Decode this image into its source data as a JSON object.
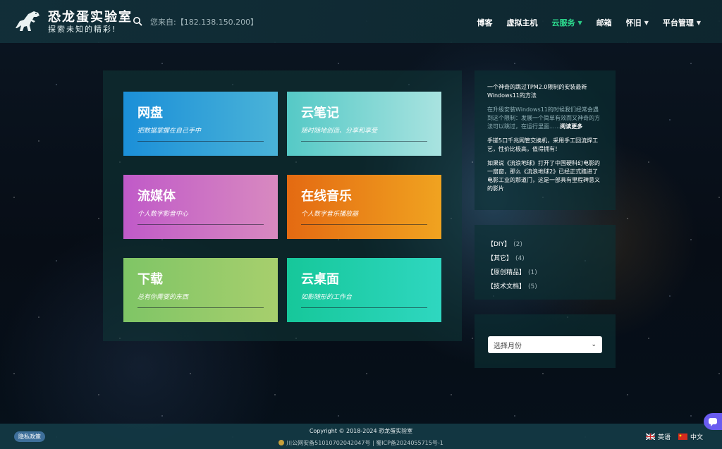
{
  "header": {
    "site_title": "恐龙蛋实验室",
    "site_subtitle": "探索未知的精彩!",
    "visitor_text": "您来自:【182.138.150.200】",
    "nav": [
      {
        "label": "博客",
        "caret": false,
        "active": false
      },
      {
        "label": "虚拟主机",
        "caret": false,
        "active": false
      },
      {
        "label": "云服务",
        "caret": true,
        "active": true
      },
      {
        "label": "邮箱",
        "caret": false,
        "active": false
      },
      {
        "label": "怀旧",
        "caret": true,
        "active": false
      },
      {
        "label": "平台管理",
        "caret": true,
        "active": false
      }
    ]
  },
  "cards": [
    {
      "title": "网盘",
      "subtitle": "把数据掌握在自己手中"
    },
    {
      "title": "云笔记",
      "subtitle": "随时随地创造、分享和享受"
    },
    {
      "title": "流媒体",
      "subtitle": "个人数字影音中心"
    },
    {
      "title": "在线音乐",
      "subtitle": "个人数字音乐播放器"
    },
    {
      "title": "下载",
      "subtitle": "总有你需要的东西"
    },
    {
      "title": "云桌面",
      "subtitle": "如影随形的工作台"
    }
  ],
  "sidebar": {
    "posts": [
      {
        "text": "一个神奇的跳过TPM2.0限制的安装最新Windows11的方法",
        "dim": false
      },
      {
        "text": "在升级安装Windows11的时候我们经常会遇到这个限制：发展一个简单有效而又神奇的方法可以跳过，在运行里面......",
        "more": "阅读更多",
        "dim": true
      },
      {
        "text": "手搓5口千兆网管交换机，采用手工回流焊工艺，性价比极高，值得拥有！",
        "dim": false
      },
      {
        "text": "如果说《流浪地球》打开了中国硬科幻电影的一扇窗，那么《流浪地球2》已经正式踏进了电影工业的那道门，这是一部具有里程碑意义的影片",
        "dim": false
      }
    ],
    "categories": [
      {
        "label": "【DIY】",
        "count": "(2)"
      },
      {
        "label": "【其它】",
        "count": "(4)"
      },
      {
        "label": "【原创精品】",
        "count": "(1)"
      },
      {
        "label": "【技术文档】",
        "count": "(5)"
      }
    ],
    "archive_placeholder": "选择月份"
  },
  "footer": {
    "privacy": "隐私政策",
    "copyright": "Copyright © 2018-2024 恐龙蛋实验室",
    "beian": "川公网安备51010702042047号 | 蜀ICP备2024055715号-1",
    "lang_en": "英语",
    "lang_zh": "中文"
  },
  "colors": {
    "accent_active": "#2ddc8f",
    "header_bg": "#12303a",
    "chat_button": "#6a5cf0"
  }
}
